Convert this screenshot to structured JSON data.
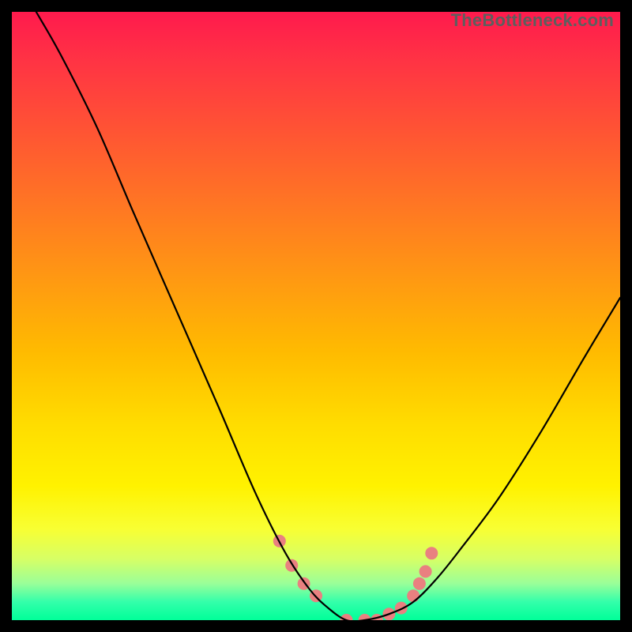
{
  "watermark": "TheBottleneck.com",
  "chart_data": {
    "type": "line",
    "title": "",
    "xlabel": "",
    "ylabel": "",
    "xlim": [
      0,
      100
    ],
    "ylim": [
      0,
      100
    ],
    "grid": false,
    "legend": false,
    "series": [
      {
        "name": "bottleneck-curve",
        "color": "#000000",
        "x": [
          4,
          8,
          14,
          20,
          27,
          34,
          40,
          45,
          49,
          52,
          55,
          58,
          62,
          66,
          70,
          74,
          80,
          87,
          94,
          100
        ],
        "y": [
          100,
          93,
          81,
          67,
          51,
          35,
          21,
          11,
          5,
          2,
          0,
          0,
          1,
          3,
          7,
          12,
          20,
          31,
          43,
          53
        ]
      }
    ],
    "markers": {
      "name": "highlight-dots",
      "color": "#e98080",
      "radius": 8,
      "x": [
        44,
        46,
        48,
        50,
        55,
        58,
        60,
        62,
        64,
        66,
        67,
        68,
        69
      ],
      "y": [
        13,
        9,
        6,
        4,
        0,
        0,
        0,
        1,
        2,
        4,
        6,
        8,
        11
      ]
    },
    "background_gradient": {
      "top": "#ff1a4d",
      "bottom": "#00ff99"
    }
  }
}
